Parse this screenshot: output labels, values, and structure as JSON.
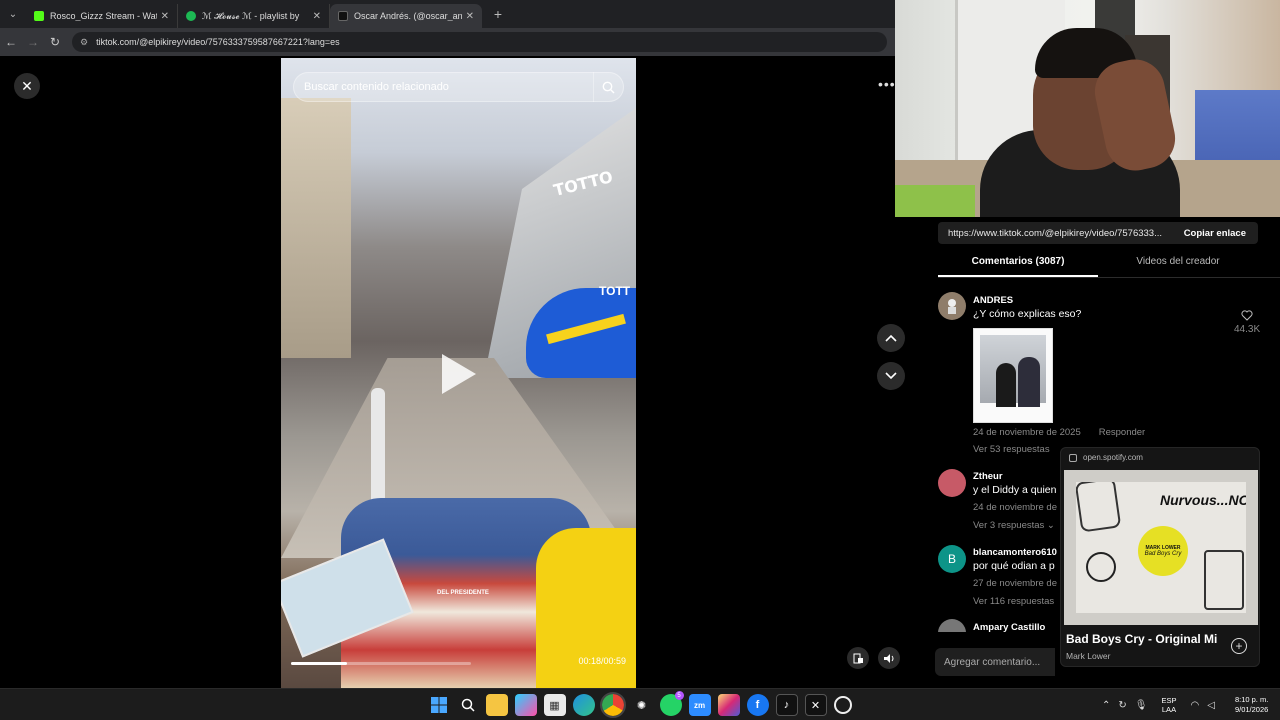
{
  "browser": {
    "tabs": [
      {
        "title": "Rosco_Gizzz Stream - Watch Live",
        "favicon_color": "#53fc18",
        "active": false
      },
      {
        "title": "ℳ 𝓗𝓸𝓾𝓼𝓮 ℳ - playlist by",
        "favicon_color": "#1db954",
        "active": false
      },
      {
        "title": "Oscar Andrés. (@oscar_andres",
        "favicon_color": "#111111",
        "active": true
      }
    ],
    "url": "tiktok.com/@elpikirey/video/7576333759587667221?lang=es"
  },
  "video": {
    "search_placeholder": "Buscar contenido relacionado",
    "store_sign": "TOTTO",
    "store_sign_2": "TOTT",
    "cart_caption": "DEL PRESIDENTE",
    "time": "00:18/00:59",
    "progress": 0.31
  },
  "share": {
    "url": "https://www.tiktok.com/@elpikirey/video/7576333...",
    "copy_label": "Copiar enlace"
  },
  "comment_tabs": [
    {
      "label": "Comentarios (3087)",
      "active": true
    },
    {
      "label": "Videos del creador",
      "active": false
    }
  ],
  "comments": [
    {
      "user": "ANDRES",
      "text": "¿Y cómo explicas eso?",
      "date": "24 de noviembre de 2025",
      "reply_label": "Responder",
      "replies": "Ver 53 respuestas",
      "likes": "44.3K",
      "avatar": "",
      "avatar_color": "#8f7d6a"
    },
    {
      "user": "Ztheur",
      "text": "y el Diddy a quien",
      "date": "24 de noviembre de",
      "replies": "Ver 3 respuestas",
      "avatar": "",
      "avatar_color": "#c75a67"
    },
    {
      "user": "blancamontero610",
      "text": "por qué odian a p",
      "date": "27 de noviembre de",
      "replies": "Ver 116 respuestas",
      "avatar": "B",
      "avatar_color": "#0d9488"
    },
    {
      "user": "Ampary Castillo",
      "avatar_color": "#777777"
    }
  ],
  "spotify": {
    "host": "open.spotify.com",
    "track": "Bad Boys Cry - Original Mi",
    "artist": "Mark Lower",
    "art_title": "Nurvous...NC",
    "sticker_line1": "MARK LOWER",
    "sticker_line2": "Bad Boys Cry"
  },
  "comment_input": {
    "placeholder": "Agregar comentario..."
  },
  "taskbar": {
    "lang_1": "ESP",
    "lang_2": "LAA",
    "time": "8:10 p. m.",
    "date": "9/01/2026",
    "whatsapp_badge": "5"
  }
}
